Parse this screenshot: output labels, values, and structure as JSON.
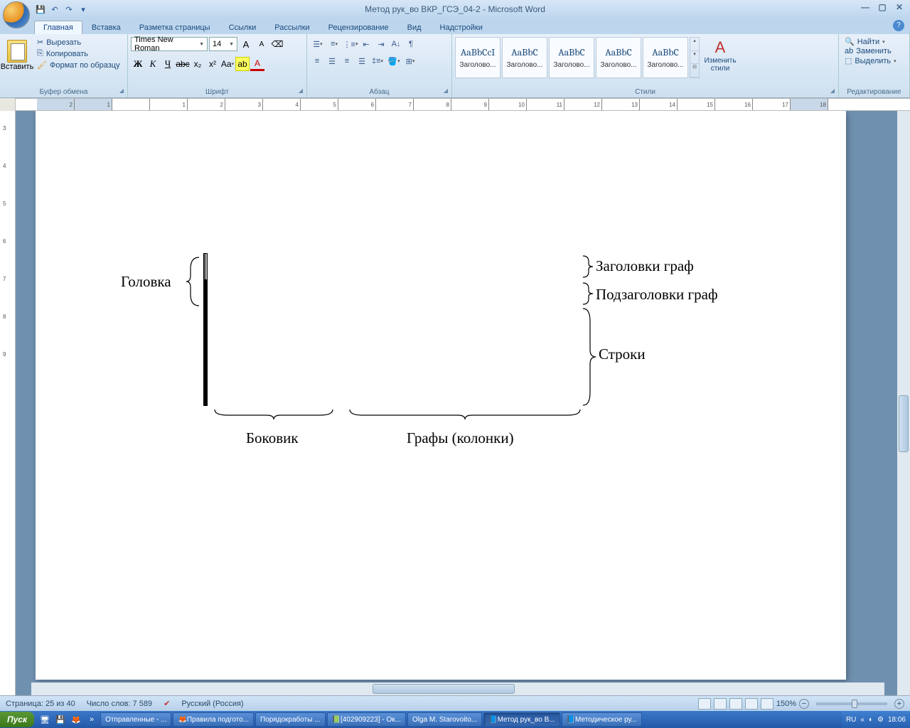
{
  "title": "Метод рук_во ВКР_ГСЭ_04-2 - Microsoft Word",
  "tabs": [
    "Главная",
    "Вставка",
    "Разметка страницы",
    "Ссылки",
    "Рассылки",
    "Рецензирование",
    "Вид",
    "Надстройки"
  ],
  "clipboard": {
    "paste": "Вставить",
    "cut": "Вырезать",
    "copy": "Копировать",
    "format": "Формат по образцу",
    "label": "Буфер обмена"
  },
  "font": {
    "name": "Times New Roman",
    "size": "14",
    "label": "Шрифт"
  },
  "paragraph": {
    "label": "Абзац"
  },
  "styles": {
    "items": [
      "Заголово...",
      "Заголово...",
      "Заголово...",
      "Заголово...",
      "Заголово..."
    ],
    "preview": "AaBbCc",
    "change": "Изменить стили",
    "label": "Стили"
  },
  "editing": {
    "find": "Найти",
    "replace": "Заменить",
    "select": "Выделить",
    "label": "Редактирование"
  },
  "diagram": {
    "golovka": "Головка",
    "zagolovki": "Заголовки граф",
    "podzagolovki": "Подзаголовки граф",
    "stroki": "Строки",
    "bokovik": "Боковик",
    "grafy": "Графы (колонки)"
  },
  "status": {
    "page": "Страница: 25 из 40",
    "words": "Число слов: 7 589",
    "lang": "Русский (Россия)",
    "zoom": "150%"
  },
  "taskbar": {
    "start": "Пуск",
    "items": [
      "Отправленные - ...",
      "Правила подгото...",
      "Порядокработы ...",
      "[402909223] - Ок...",
      "Olga M. Starovoito...",
      "Метод рук_во В...",
      "Методическое ру..."
    ],
    "lang": "RU",
    "time": "18:06"
  }
}
